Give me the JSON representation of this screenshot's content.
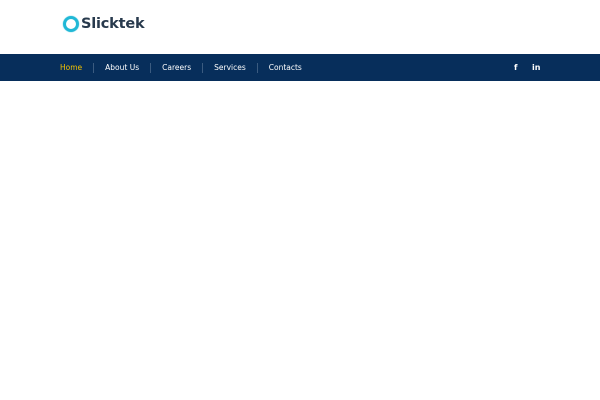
{
  "brand": {
    "logo_text": "Slicktek",
    "logo_color": "#283a4d",
    "logo_mark_color": "#21b8d6"
  },
  "nav": {
    "background": "#072e5b",
    "active_color": "#f2c100",
    "items": [
      {
        "label": "Home",
        "active": true
      },
      {
        "label": "About Us",
        "active": false
      },
      {
        "label": "Careers",
        "active": false
      },
      {
        "label": "Services",
        "active": false
      },
      {
        "label": "Contacts",
        "active": false
      }
    ]
  },
  "social": {
    "facebook": {
      "icon": "facebook-icon",
      "glyph": "f"
    },
    "linkedin": {
      "icon": "linkedin-icon",
      "glyph": "in"
    }
  }
}
